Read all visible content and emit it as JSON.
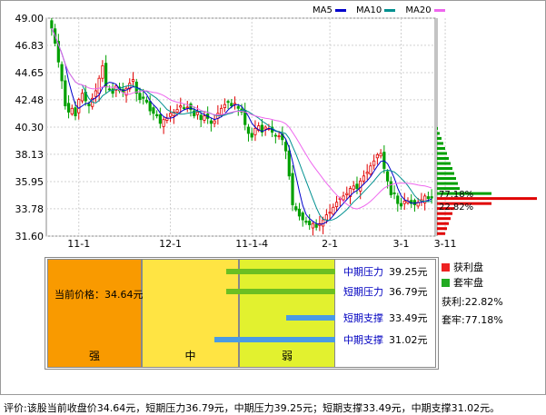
{
  "legend": [
    {
      "label": "MA5",
      "color": "#0000cc"
    },
    {
      "label": "MA10",
      "color": "#009090"
    },
    {
      "label": "MA20",
      "color": "#ee66ee"
    }
  ],
  "chart_data": {
    "type": "candlestick",
    "yticks": [
      "49.00",
      "46.83",
      "44.65",
      "42.48",
      "40.30",
      "38.13",
      "35.95",
      "33.78",
      "31.60"
    ],
    "ylim": [
      31.6,
      49.0
    ],
    "xticks": [
      "11-1",
      "12-1",
      "11-1-4",
      "2-1",
      "3-1",
      "3-11"
    ],
    "xtick_index": [
      8,
      35,
      59,
      82,
      103,
      116
    ],
    "series_names": [
      "MA5",
      "MA10",
      "MA20"
    ],
    "up_color": "#e00000",
    "down_color": "#00a000",
    "closes": [
      48.2,
      47.0,
      45.5,
      44.0,
      42.0,
      41.5,
      41.8,
      41.2,
      42.5,
      43.0,
      42.4,
      42.0,
      42.6,
      43.2,
      44.2,
      45.2,
      43.5,
      43.3,
      43.0,
      43.6,
      43.2,
      43.1,
      43.4,
      43.8,
      44.1,
      43.0,
      42.5,
      42.6,
      42.3,
      41.6,
      41.4,
      41.2,
      40.6,
      40.9,
      41.0,
      41.4,
      41.5,
      41.7,
      42.0,
      41.8,
      41.9,
      41.7,
      41.2,
      41.5,
      40.9,
      41.2,
      41.0,
      40.6,
      40.8,
      41.4,
      41.8,
      42.1,
      42.3,
      42.0,
      42.2,
      41.8,
      41.5,
      40.5,
      39.8,
      39.5,
      40.2,
      40.4,
      39.9,
      40.3,
      40.2,
      39.9,
      39.6,
      39.6,
      39.3,
      38.4,
      36.4,
      34.1,
      33.7,
      33.2,
      32.9,
      32.7,
      32.5,
      32.6,
      32.3,
      32.6,
      32.9,
      33.3,
      33.5,
      33.9,
      34.3,
      34.6,
      34.8,
      35.0,
      35.4,
      35.6,
      35.4,
      36.0,
      36.4,
      36.7,
      37.2,
      37.6,
      38.1,
      38.2,
      37.0,
      36.0,
      34.9,
      35.0,
      34.2,
      34.0,
      34.4,
      34.4,
      34.2,
      34.1,
      34.3,
      34.5,
      34.8,
      34.6,
      34.64
    ],
    "ma_colors": [
      "#0000cc",
      "#009090",
      "#ee66ee"
    ],
    "cost_distribution": {
      "profit_pct": 22.82,
      "trapped_pct": 77.18
    }
  },
  "panel": {
    "current_price_label": "当前价格：34.64元",
    "zones": [
      "强",
      "中",
      "弱"
    ],
    "levels": [
      {
        "name": "中期压力",
        "value": "39.25元",
        "color": "#6cbf22",
        "start": 0.62
      },
      {
        "name": "短期压力",
        "value": "36.79元",
        "color": "#6cbf22",
        "start": 0.62
      },
      {
        "name": "短期支撑",
        "value": "33.49元",
        "color": "#4b9be3",
        "start": 0.83
      },
      {
        "name": "中期支撑",
        "value": "31.02元",
        "color": "#4b9be3",
        "start": 0.58
      }
    ]
  },
  "profit_panel": {
    "legend_profit": "获利盘",
    "legend_trapped": "套牢盘",
    "profit_color": "#ee2222",
    "trapped_color": "#22aa22",
    "profit_text": "获利:22.82%",
    "trapped_text": "套牢:77.18%",
    "chart_label_trapped": "77.18%",
    "chart_label_profit": "22.82%"
  },
  "footer": {
    "text": "评价:该股当前收盘价34.64元，短期压力36.79元，中期压力39.25元；短期支撑33.49元，中期支撑31.02元。"
  }
}
